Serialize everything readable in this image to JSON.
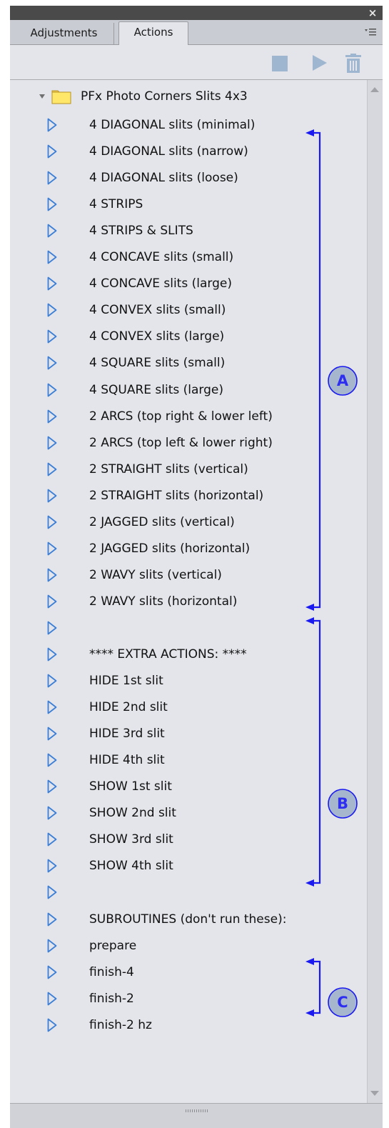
{
  "window": {
    "close_glyph": "×"
  },
  "tabs": [
    {
      "label": "Adjustments",
      "active": false
    },
    {
      "label": "Actions",
      "active": true
    }
  ],
  "panel_menu_icon": "panel-menu-icon",
  "toolbar": {
    "buttons": [
      "stop-icon",
      "play-icon",
      "trash-icon"
    ]
  },
  "action_set": {
    "label": "PFx Photo Corners Slits 4x3",
    "expanded": true,
    "icon": "folder-icon"
  },
  "actions": [
    "4 DIAGONAL slits (minimal)",
    "4 DIAGONAL slits (narrow)",
    "4 DIAGONAL slits (loose)",
    "4 STRIPS",
    "4 STRIPS & SLITS",
    "4 CONCAVE slits (small)",
    "4 CONCAVE slits (large)",
    "4 CONVEX slits (small)",
    "4 CONVEX slits (large)",
    "4 SQUARE slits (small)",
    "4 SQUARE slits (large)",
    "2 ARCS (top right & lower left)",
    "2 ARCS (top left & lower right)",
    "2 STRAIGHT slits (vertical)",
    "2 STRAIGHT slits (horizontal)",
    "2 JAGGED slits (vertical)",
    "2 JAGGED slits (horizontal)",
    "2 WAVY slits (vertical)",
    "2 WAVY slits (horizontal)",
    "",
    "**** EXTRA ACTIONS: ****",
    "HIDE 1st slit",
    "HIDE 2nd slit",
    "HIDE 3rd slit",
    "HIDE 4th slit",
    "SHOW 1st slit",
    "SHOW 2nd slit",
    "SHOW 3rd slit",
    "SHOW 4th slit",
    "",
    "SUBROUTINES (don't run these):",
    "prepare",
    "finish-4",
    "finish-2",
    "finish-2 hz"
  ],
  "annotations": [
    {
      "label": "A",
      "color": "#1a1af0",
      "badge_fill": "#a6b6cc"
    },
    {
      "label": "B",
      "color": "#1a1af0",
      "badge_fill": "#a6b6cc"
    },
    {
      "label": "C",
      "color": "#1a1af0",
      "badge_fill": "#a6b6cc"
    }
  ]
}
